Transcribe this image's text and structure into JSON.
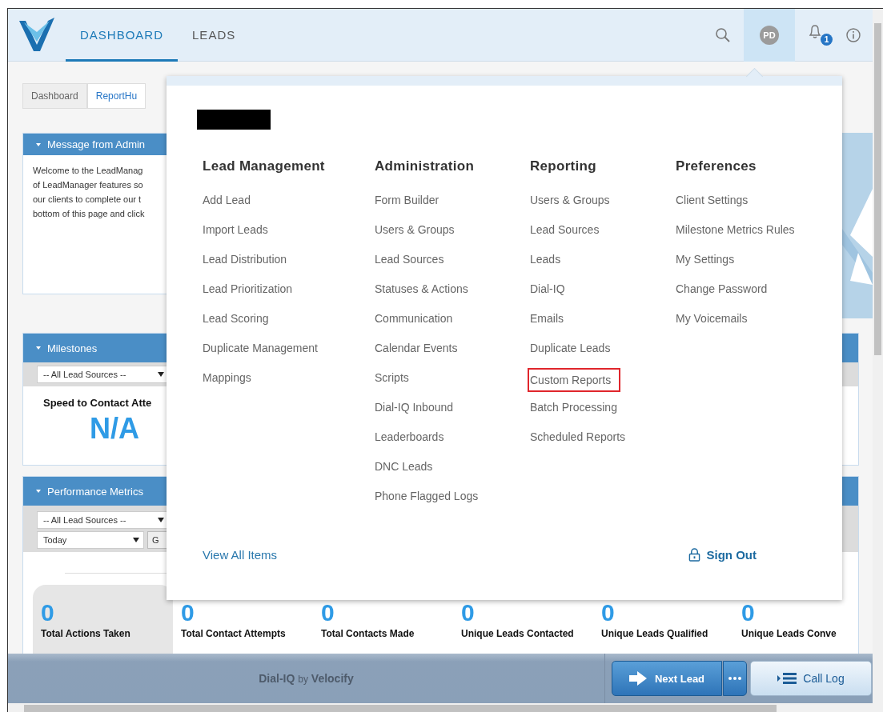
{
  "nav": {
    "tabs": [
      {
        "label": "DASHBOARD",
        "selected": true
      },
      {
        "label": "LEADS",
        "selected": false
      }
    ],
    "avatar": {
      "initials": "PD",
      "selected": true
    },
    "notification_count": "1"
  },
  "subtabs": [
    {
      "label": "Dashboard",
      "selected": false
    },
    {
      "label": "ReportHu",
      "selected": true
    }
  ],
  "message_panel": {
    "title": "Message from Admin",
    "lines": [
      "Welcome to the LeadManag",
      "of LeadManager features so",
      "our clients to complete our t",
      "bottom of this page and click"
    ]
  },
  "milestones_panel": {
    "title": "Milestones",
    "select": "-- All Lead Sources --",
    "metric_label": "Speed to Contact Atte",
    "metric_value": "N/A"
  },
  "performance_panel": {
    "title": "Performance Metrics",
    "source_select": "-- All Lead Sources --",
    "period_select": "Today",
    "go_button": "G",
    "metrics": [
      {
        "value": "0",
        "label": "Total Actions Taken",
        "selected": true
      },
      {
        "value": "0",
        "label": "Total Contact Attempts",
        "selected": false
      },
      {
        "value": "0",
        "label": "Total Contacts Made",
        "selected": false
      },
      {
        "value": "0",
        "label": "Unique Leads Contacted",
        "selected": false
      },
      {
        "value": "0",
        "label": "Unique Leads Qualified",
        "selected": false
      },
      {
        "value": "0",
        "label": "Unique Leads Conve",
        "selected": false
      }
    ]
  },
  "menu": {
    "columns": [
      {
        "heading": "Lead Management",
        "items": [
          {
            "label": "Add Lead",
            "highlighted": false
          },
          {
            "label": "Import Leads",
            "highlighted": false
          },
          {
            "label": "Lead Distribution",
            "highlighted": false
          },
          {
            "label": "Lead Prioritization",
            "highlighted": false
          },
          {
            "label": "Lead Scoring",
            "highlighted": false
          },
          {
            "label": "Duplicate Management",
            "highlighted": false
          },
          {
            "label": "Mappings",
            "highlighted": false
          }
        ]
      },
      {
        "heading": "Administration",
        "items": [
          {
            "label": "Form Builder",
            "highlighted": false
          },
          {
            "label": "Users & Groups",
            "highlighted": false
          },
          {
            "label": "Lead Sources",
            "highlighted": false
          },
          {
            "label": "Statuses & Actions",
            "highlighted": false
          },
          {
            "label": "Communication",
            "highlighted": false
          },
          {
            "label": "Calendar Events",
            "highlighted": false
          },
          {
            "label": "Scripts",
            "highlighted": false
          },
          {
            "label": "Dial-IQ Inbound",
            "highlighted": false
          },
          {
            "label": "Leaderboards",
            "highlighted": false
          },
          {
            "label": "DNC Leads",
            "highlighted": false
          },
          {
            "label": "Phone Flagged Logs",
            "highlighted": false
          }
        ]
      },
      {
        "heading": "Reporting",
        "items": [
          {
            "label": "Users & Groups",
            "highlighted": false
          },
          {
            "label": "Lead Sources",
            "highlighted": false
          },
          {
            "label": "Leads",
            "highlighted": false
          },
          {
            "label": "Dial-IQ",
            "highlighted": false
          },
          {
            "label": "Emails",
            "highlighted": false
          },
          {
            "label": "Duplicate Leads",
            "highlighted": false
          },
          {
            "label": "Custom Reports",
            "highlighted": true
          },
          {
            "label": "Batch Processing",
            "highlighted": false
          },
          {
            "label": "Scheduled Reports",
            "highlighted": false
          }
        ]
      },
      {
        "heading": "Preferences",
        "items": [
          {
            "label": "Client Settings",
            "highlighted": false
          },
          {
            "label": "Milestone Metrics Rules",
            "highlighted": false
          },
          {
            "label": "My Settings",
            "highlighted": false
          },
          {
            "label": "Change Password",
            "highlighted": false
          },
          {
            "label": "My Voicemails",
            "highlighted": false
          }
        ]
      }
    ],
    "view_all": "View All Items",
    "sign_out": "Sign Out"
  },
  "footer": {
    "brand": "Dial-IQ",
    "by": "by",
    "company": "Velocify",
    "next_lead": "Next Lead",
    "call_log": "Call Log"
  }
}
